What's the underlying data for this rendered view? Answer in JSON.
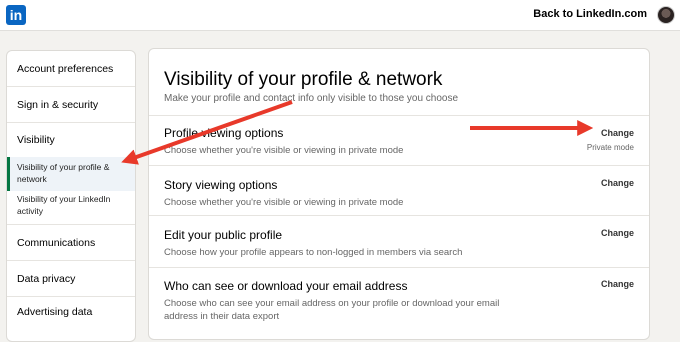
{
  "header": {
    "logo_text": "in",
    "back_link": "Back to LinkedIn.com"
  },
  "sidebar": {
    "items": [
      {
        "label": "Account preferences"
      },
      {
        "label": "Sign in & security"
      },
      {
        "label": "Visibility"
      },
      {
        "label": "Visibility of your profile & network"
      },
      {
        "label": "Visibility of your LinkedIn activity"
      },
      {
        "label": "Communications"
      },
      {
        "label": "Data privacy"
      },
      {
        "label": "Advertising data"
      }
    ]
  },
  "main": {
    "title": "Visibility of your profile & network",
    "subtitle": "Make your profile and contact info only visible to those you choose",
    "rows": [
      {
        "title": "Profile viewing options",
        "desc": "Choose whether you're visible or viewing in private mode",
        "action": "Change",
        "status": "Private mode"
      },
      {
        "title": "Story viewing options",
        "desc": "Choose whether you're visible or viewing in private mode",
        "action": "Change"
      },
      {
        "title": "Edit your public profile",
        "desc": "Choose how your profile appears to non-logged in members via search",
        "action": "Change"
      },
      {
        "title": "Who can see or download your email address",
        "desc": "Choose who can see your email address on your profile or download your email address in their data export",
        "action": "Change"
      }
    ]
  },
  "colors": {
    "brand": "#0a66c2",
    "active_indicator": "#057642",
    "annotation_arrow": "#e8392a"
  }
}
